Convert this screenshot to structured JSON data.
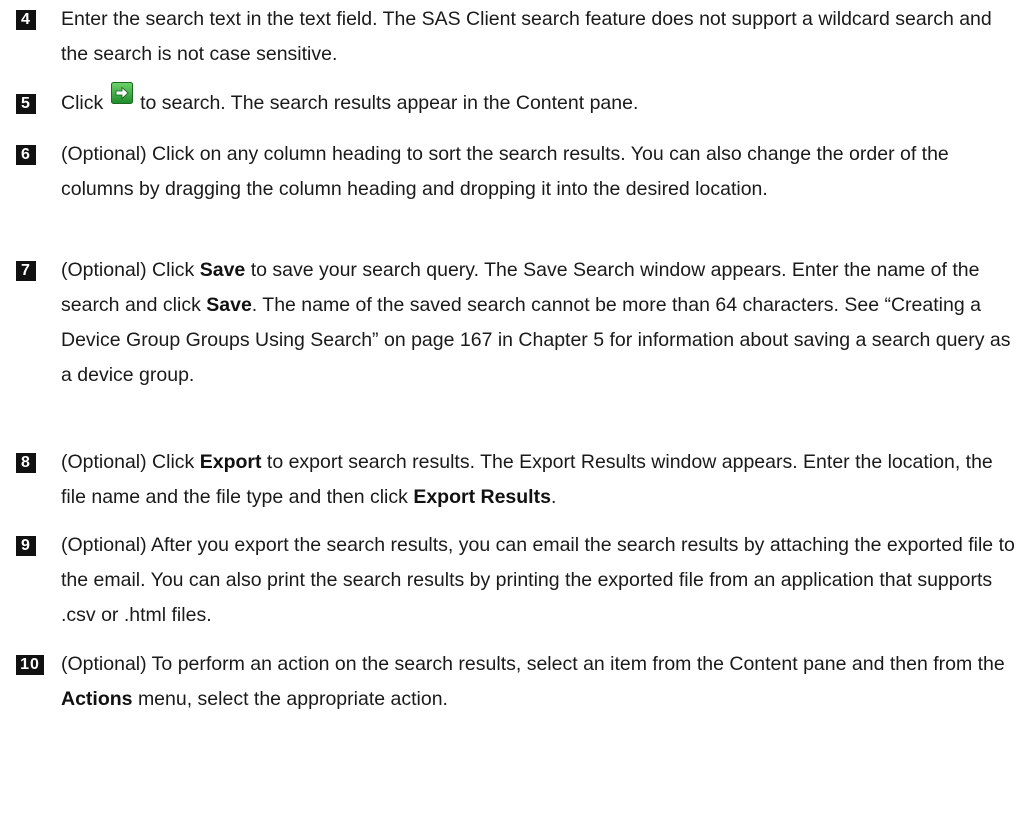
{
  "steps": [
    {
      "number": "4",
      "text": "Enter the search text in the text field. The SAS Client search feature does not support a wildcard search and the search is not case sensitive."
    },
    {
      "number": "5",
      "before": "Click",
      "icon": "green-arrow-go-icon",
      "after": "to search. The search results appear in the Content pane."
    },
    {
      "number": "6",
      "text": "(Optional) Click on any column heading to sort the search results. You can also change the order of the columns by dragging the column heading and dropping it into the desired location."
    },
    {
      "number": "7",
      "t1": "(Optional) Click",
      "b1": "Save",
      "t2": "to save your search query. The Save Search window appears. Enter the name of the search and click",
      "b2": "Save",
      "t3": ". The name of the saved search cannot be more than 64 characters. See “Creating a Device Group Groups Using Search” on page 167 in Chapter 5 for information about saving a search query as a device group."
    },
    {
      "number": "8",
      "t1": "(Optional) Click",
      "b1": "Export",
      "t2": "to export search results. The Export Results window appears. Enter the location, the file name and the file type and then click",
      "b2": "Export Results",
      "t3": "."
    },
    {
      "number": "9",
      "text": "(Optional) After you export the search results, you can email the search results by attaching the exported file to the email. You can also print the search results by printing the exported file from an application that supports .csv or .html files."
    },
    {
      "number": "10",
      "t1": "(Optional) To perform an action on the search results, select an item from the Content pane and then from the",
      "b1": "Actions",
      "t2": "menu, select the appropriate action."
    }
  ],
  "colors": {
    "text": "#1a1a1a",
    "badge_bg": "#111111",
    "icon_green": "#2e9e3e"
  }
}
